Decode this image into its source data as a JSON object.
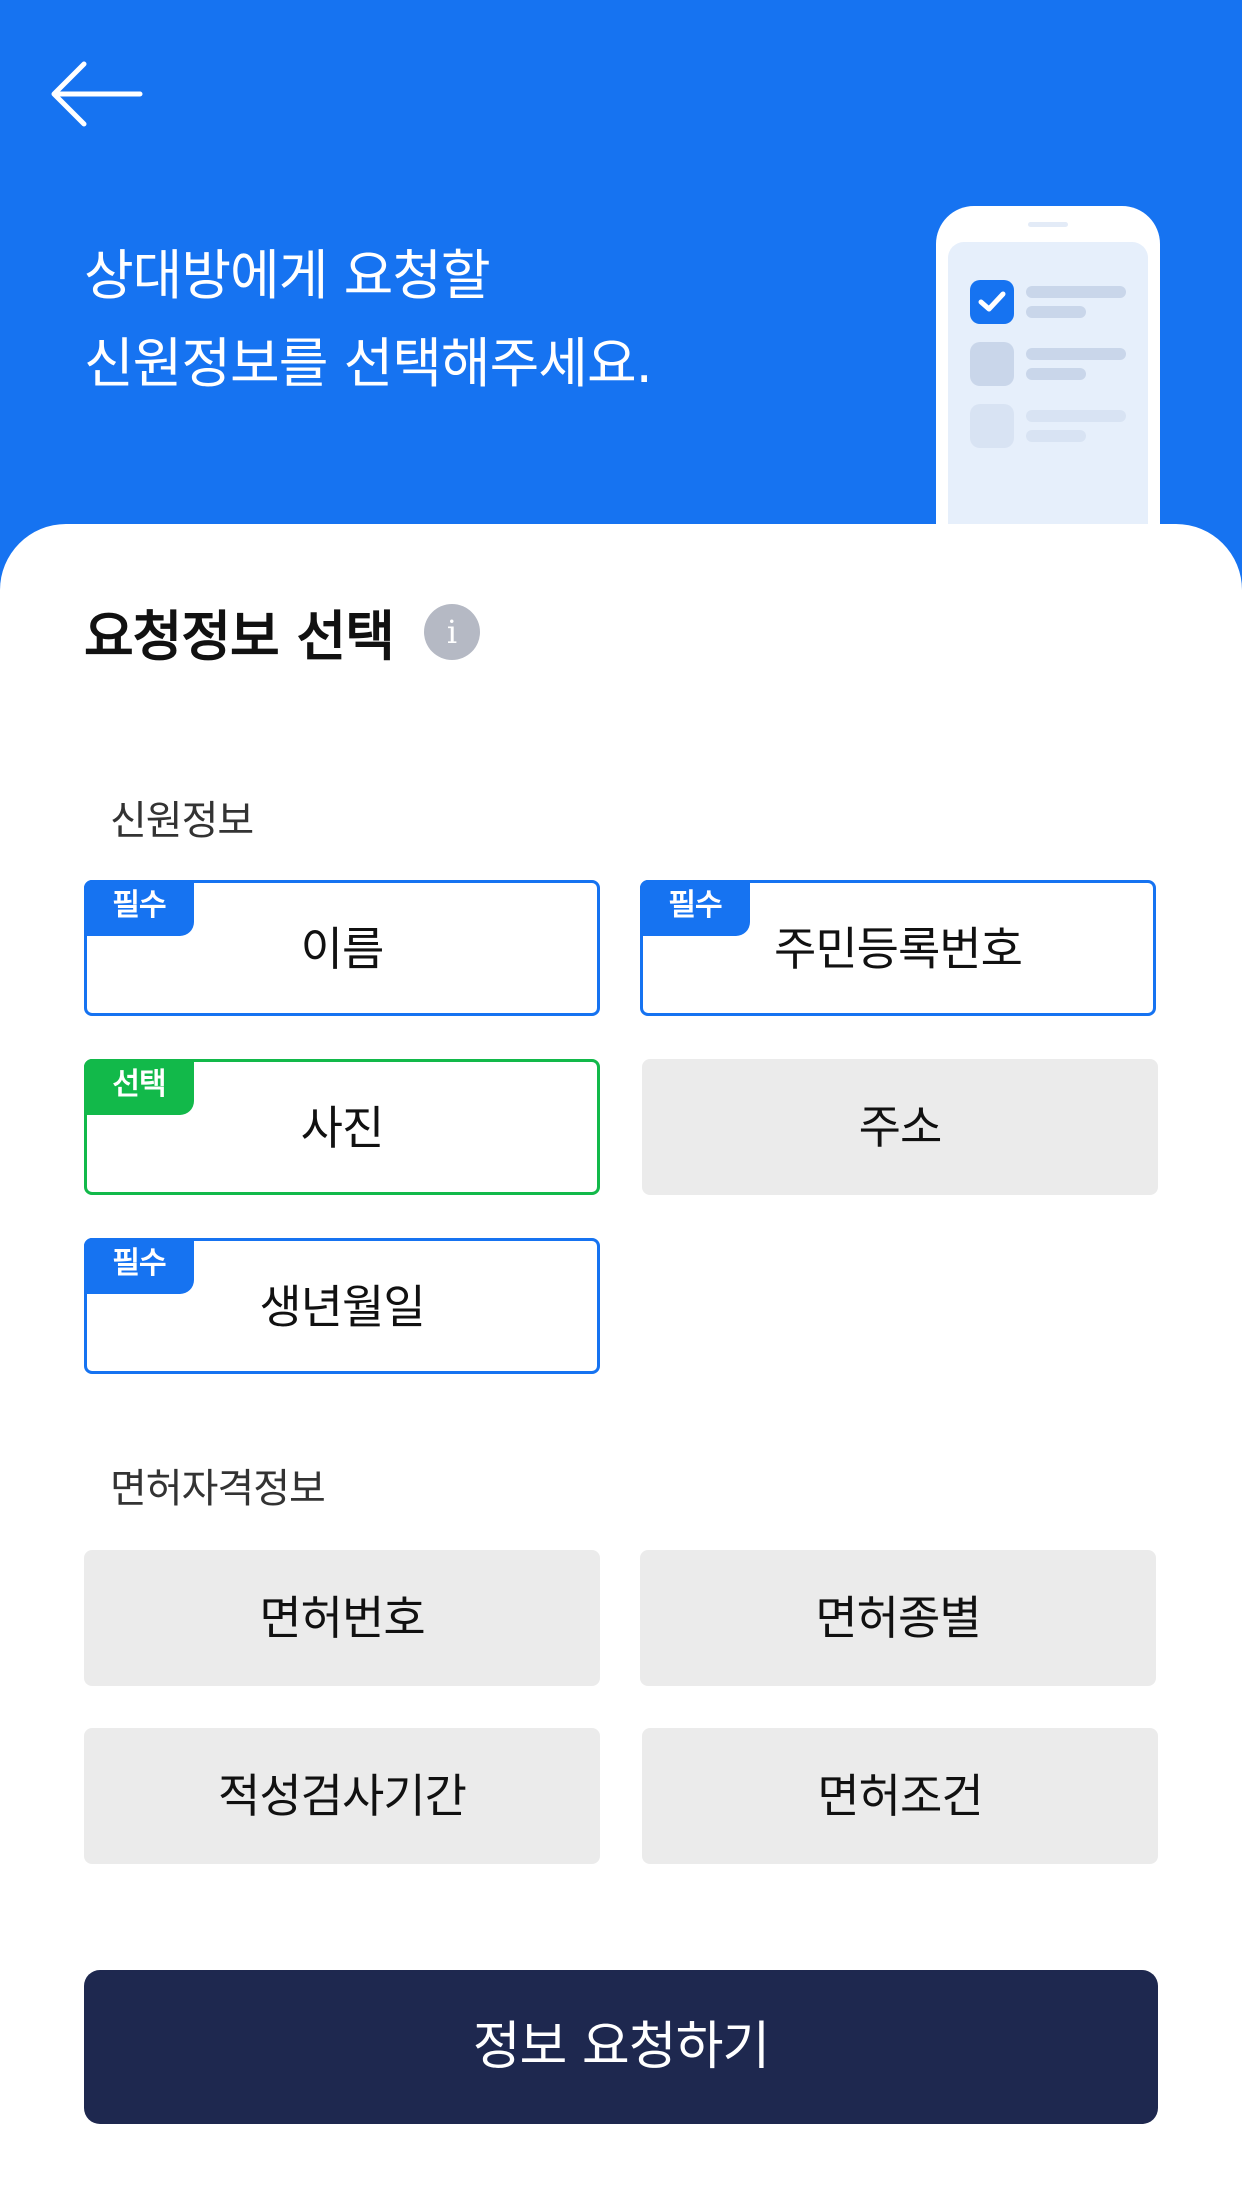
{
  "header": {
    "back_icon": "arrow-left-icon",
    "title_line1": "상대방에게 요청할",
    "title_line2": "신원정보를 선택해주세요."
  },
  "main": {
    "section_title": "요청정보 선택",
    "info_icon_glyph": "i",
    "identity_group": {
      "label": "신원정보",
      "items": [
        {
          "label": "이름",
          "badge": "필수",
          "state": "required"
        },
        {
          "label": "주민등록번호",
          "badge": "필수",
          "state": "required"
        },
        {
          "label": "사진",
          "badge": "선택",
          "state": "selected"
        },
        {
          "label": "주소",
          "badge": "",
          "state": "unselected"
        },
        {
          "label": "생년월일",
          "badge": "필수",
          "state": "required"
        }
      ]
    },
    "license_group": {
      "label": "면허자격정보",
      "items": [
        {
          "label": "면허번호",
          "state": "unselected"
        },
        {
          "label": "면허종별",
          "state": "unselected"
        },
        {
          "label": "적성검사기간",
          "state": "unselected"
        },
        {
          "label": "면허조건",
          "state": "unselected"
        }
      ]
    },
    "submit_label": "정보 요청하기"
  },
  "colors": {
    "primary_blue": "#1673f1",
    "selected_green": "#12b94a",
    "unselected_gray": "#ebebeb",
    "submit_navy": "#1e284f"
  }
}
